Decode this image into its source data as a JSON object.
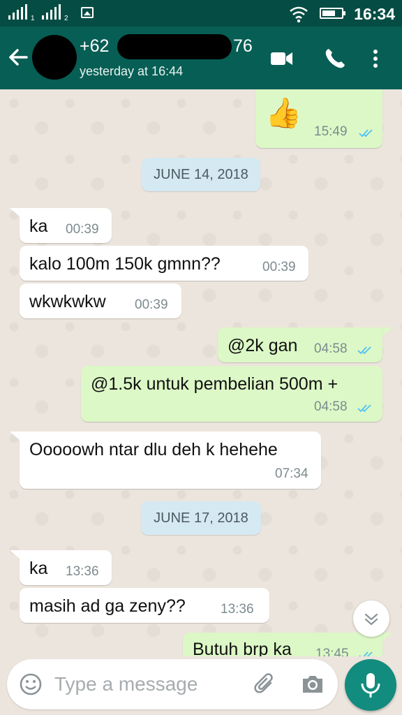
{
  "status_bar": {
    "sim1": "1",
    "sim2": "2",
    "time": "16:34"
  },
  "header": {
    "contact_prefix": "+62",
    "contact_suffix": "76",
    "last_seen": "yesterday at 16:44"
  },
  "messages": [
    {
      "kind": "out",
      "emoji": "👍",
      "time": "15:49",
      "status": "read"
    },
    {
      "kind": "date",
      "label": "JUNE 14, 2018"
    },
    {
      "kind": "in",
      "text": "ka",
      "time": "00:39"
    },
    {
      "kind": "in",
      "text": "kalo 100m 150k gmnn??",
      "time": "00:39"
    },
    {
      "kind": "in",
      "text": "wkwkwkw",
      "time": "00:39"
    },
    {
      "kind": "out",
      "text": "@2k gan",
      "time": "04:58",
      "status": "read"
    },
    {
      "kind": "out",
      "text": "@1.5k untuk pembelian 500m +",
      "time": "04:58",
      "status": "read"
    },
    {
      "kind": "in",
      "text": "Ooooowh ntar dlu deh k hehehe",
      "time": "07:34"
    },
    {
      "kind": "date",
      "label": "JUNE 17, 2018"
    },
    {
      "kind": "in",
      "text": "ka",
      "time": "13:36"
    },
    {
      "kind": "in",
      "text": "masih ad ga zeny??",
      "time": "13:36"
    },
    {
      "kind": "out",
      "text": "Butuh brp ka",
      "time": "13:45",
      "status": "read"
    }
  ],
  "composer": {
    "placeholder": "Type a message"
  },
  "colors": {
    "toolbar": "#075e54",
    "status_bar": "#054d44",
    "outgoing_bubble": "#dcf8c6",
    "incoming_bubble": "#ffffff",
    "read_ticks": "#4fc3f7",
    "send_button": "#128c7e"
  },
  "icons": [
    "back-arrow-icon",
    "video-call-icon",
    "voice-call-icon",
    "more-options-icon",
    "emoji-icon",
    "attach-icon",
    "camera-icon",
    "mic-icon",
    "scroll-down-icon"
  ]
}
